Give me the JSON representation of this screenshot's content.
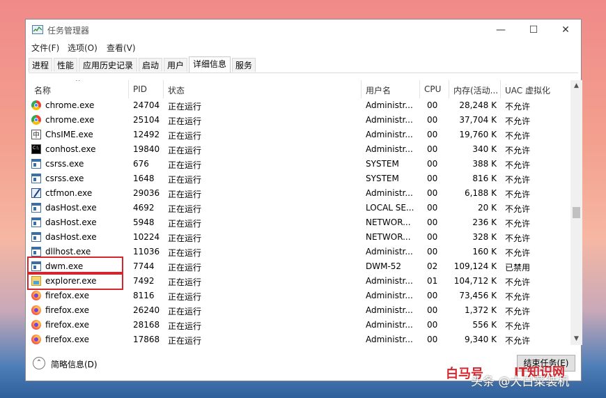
{
  "window": {
    "title": "任务管理器",
    "controls": [
      "—",
      "☐",
      "✕"
    ]
  },
  "menu": [
    "文件(F)",
    "选项(O)",
    "查看(V)"
  ],
  "tabs": [
    {
      "label": "进程",
      "active": false
    },
    {
      "label": "性能",
      "active": false
    },
    {
      "label": "应用历史记录",
      "active": false
    },
    {
      "label": "启动",
      "active": false
    },
    {
      "label": "用户",
      "active": false
    },
    {
      "label": "详细信息",
      "active": true
    },
    {
      "label": "服务",
      "active": false
    }
  ],
  "columns": [
    "名称",
    "PID",
    "状态",
    "用户名",
    "CPU",
    "内存(活动...",
    "UAC 虚拟化"
  ],
  "sort_indicator": "^",
  "rows": [
    {
      "icon": "chrome-icon",
      "name": "chrome.exe",
      "pid": "24704",
      "status": "正在运行",
      "user": "Administr...",
      "cpu": "00",
      "mem": "28,248 K",
      "uac": "不允许"
    },
    {
      "icon": "chrome-icon",
      "name": "chrome.exe",
      "pid": "25104",
      "status": "正在运行",
      "user": "Administr...",
      "cpu": "00",
      "mem": "37,704 K",
      "uac": "不允许"
    },
    {
      "icon": "ime-icon",
      "name": "ChsIME.exe",
      "pid": "12492",
      "status": "正在运行",
      "user": "Administr...",
      "cpu": "00",
      "mem": "19,760 K",
      "uac": "不允许"
    },
    {
      "icon": "console-icon",
      "name": "conhost.exe",
      "pid": "19840",
      "status": "正在运行",
      "user": "Administr...",
      "cpu": "00",
      "mem": "340 K",
      "uac": "不允许"
    },
    {
      "icon": "system-process-icon",
      "name": "csrss.exe",
      "pid": "676",
      "status": "正在运行",
      "user": "SYSTEM",
      "cpu": "00",
      "mem": "388 K",
      "uac": "不允许"
    },
    {
      "icon": "system-process-icon",
      "name": "csrss.exe",
      "pid": "1648",
      "status": "正在运行",
      "user": "SYSTEM",
      "cpu": "00",
      "mem": "816 K",
      "uac": "不允许"
    },
    {
      "icon": "ctfmon-icon",
      "name": "ctfmon.exe",
      "pid": "29036",
      "status": "正在运行",
      "user": "Administr...",
      "cpu": "00",
      "mem": "6,188 K",
      "uac": "不允许"
    },
    {
      "icon": "system-process-icon",
      "name": "dasHost.exe",
      "pid": "4692",
      "status": "正在运行",
      "user": "LOCAL SE...",
      "cpu": "00",
      "mem": "20 K",
      "uac": "不允许"
    },
    {
      "icon": "system-process-icon",
      "name": "dasHost.exe",
      "pid": "5948",
      "status": "正在运行",
      "user": "NETWOR...",
      "cpu": "00",
      "mem": "236 K",
      "uac": "不允许"
    },
    {
      "icon": "system-process-icon",
      "name": "dasHost.exe",
      "pid": "10224",
      "status": "正在运行",
      "user": "NETWOR...",
      "cpu": "00",
      "mem": "328 K",
      "uac": "不允许"
    },
    {
      "icon": "system-process-icon",
      "name": "dllhost.exe",
      "pid": "11036",
      "status": "正在运行",
      "user": "Administr...",
      "cpu": "00",
      "mem": "160 K",
      "uac": "不允许"
    },
    {
      "icon": "system-process-icon",
      "name": "dwm.exe",
      "pid": "7744",
      "status": "正在运行",
      "user": "DWM-52",
      "cpu": "02",
      "mem": "109,124 K",
      "uac": "已禁用",
      "highlighted": true
    },
    {
      "icon": "explorer-icon",
      "name": "explorer.exe",
      "pid": "7492",
      "status": "正在运行",
      "user": "Administr...",
      "cpu": "01",
      "mem": "104,712 K",
      "uac": "不允许",
      "highlighted": true
    },
    {
      "icon": "firefox-icon",
      "name": "firefox.exe",
      "pid": "8116",
      "status": "正在运行",
      "user": "Administr...",
      "cpu": "00",
      "mem": "73,456 K",
      "uac": "不允许"
    },
    {
      "icon": "firefox-icon",
      "name": "firefox.exe",
      "pid": "26240",
      "status": "正在运行",
      "user": "Administr...",
      "cpu": "00",
      "mem": "1,372 K",
      "uac": "不允许"
    },
    {
      "icon": "firefox-icon",
      "name": "firefox.exe",
      "pid": "28168",
      "status": "正在运行",
      "user": "Administr...",
      "cpu": "00",
      "mem": "556 K",
      "uac": "不允许"
    },
    {
      "icon": "firefox-icon",
      "name": "firefox.exe",
      "pid": "17868",
      "status": "正在运行",
      "user": "Administr...",
      "cpu": "00",
      "mem": "9,340 K",
      "uac": "不允许"
    }
  ],
  "scroll": {
    "up": "▲",
    "down": "▼",
    "position_fraction": 0.5
  },
  "footer": {
    "toggle_symbol": "⌃",
    "fewer_details": "简略信息(D)",
    "end_task": "结束任务(E)"
  },
  "watermarks": {
    "left_text": "白马号",
    "right_text": "IT知识网",
    "toutiao": "头条 @大白菜装机"
  },
  "colors": {
    "highlight_box": "#d3262e",
    "window_bg": "#ffffff"
  }
}
